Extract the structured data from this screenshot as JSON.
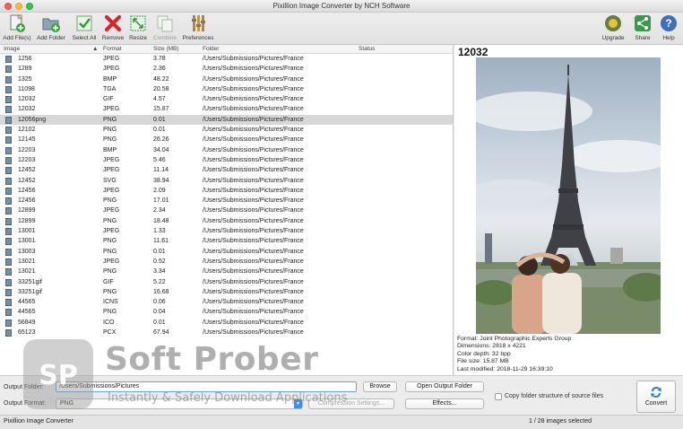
{
  "window": {
    "title": "Pixillion Image Converter by NCH Software"
  },
  "toolbar": {
    "buttons": [
      {
        "label": "Add File(s)",
        "icon": "add-file-icon",
        "enabled": true
      },
      {
        "label": "Add Folder",
        "icon": "add-folder-icon",
        "enabled": true
      },
      {
        "label": "Select All",
        "icon": "select-all-icon",
        "enabled": true
      },
      {
        "label": "Remove",
        "icon": "remove-icon",
        "enabled": true
      },
      {
        "label": "Resize",
        "icon": "resize-icon",
        "enabled": true
      },
      {
        "label": "Combine",
        "icon": "combine-icon",
        "enabled": false
      },
      {
        "label": "Preferences",
        "icon": "preferences-icon",
        "enabled": true
      }
    ],
    "right_buttons": [
      {
        "label": "Upgrade",
        "icon": "upgrade-icon"
      },
      {
        "label": "Share",
        "icon": "share-icon"
      },
      {
        "label": "Help",
        "icon": "help-icon"
      }
    ]
  },
  "file_list": {
    "columns": {
      "image": "Image",
      "format": "Format",
      "size": "Size (MB)",
      "folder": "Folder",
      "status": "Status"
    },
    "selected_index": 6,
    "rows": [
      {
        "image": "1256",
        "format": "JPEG",
        "size": "3.78",
        "folder": "/Users/Submissions/Pictures/France"
      },
      {
        "image": "1289",
        "format": "JPEG",
        "size": "2.36",
        "folder": "/Users/Submissions/Pictures/France"
      },
      {
        "image": "1325",
        "format": "BMP",
        "size": "48.22",
        "folder": "/Users/Submissions/Pictures/France"
      },
      {
        "image": "11098",
        "format": "TGA",
        "size": "20.58",
        "folder": "/Users/Submissions/Pictures/France"
      },
      {
        "image": "12032",
        "format": "GIF",
        "size": "4.57",
        "folder": "/Users/Submissions/Pictures/France"
      },
      {
        "image": "12032",
        "format": "JPEG",
        "size": "15.87",
        "folder": "/Users/Submissions/Pictures/France"
      },
      {
        "image": "12056png",
        "format": "PNG",
        "size": "0.01",
        "folder": "/Users/Submissions/Pictures/France"
      },
      {
        "image": "12102",
        "format": "PNG",
        "size": "0.01",
        "folder": "/Users/Submissions/Pictures/France"
      },
      {
        "image": "12145",
        "format": "PNG",
        "size": "26.26",
        "folder": "/Users/Submissions/Pictures/France"
      },
      {
        "image": "12203",
        "format": "BMP",
        "size": "34.04",
        "folder": "/Users/Submissions/Pictures/France"
      },
      {
        "image": "12203",
        "format": "JPEG",
        "size": "5.46",
        "folder": "/Users/Submissions/Pictures/France"
      },
      {
        "image": "12452",
        "format": "JPEG",
        "size": "11.14",
        "folder": "/Users/Submissions/Pictures/France"
      },
      {
        "image": "12452",
        "format": "SVG",
        "size": "38.94",
        "folder": "/Users/Submissions/Pictures/France"
      },
      {
        "image": "12456",
        "format": "JPEG",
        "size": "2.09",
        "folder": "/Users/Submissions/Pictures/France"
      },
      {
        "image": "12456",
        "format": "PNG",
        "size": "17.01",
        "folder": "/Users/Submissions/Pictures/France"
      },
      {
        "image": "12899",
        "format": "JPEG",
        "size": "2.34",
        "folder": "/Users/Submissions/Pictures/France"
      },
      {
        "image": "12899",
        "format": "PNG",
        "size": "18.48",
        "folder": "/Users/Submissions/Pictures/France"
      },
      {
        "image": "13001",
        "format": "JPEG",
        "size": "1.33",
        "folder": "/Users/Submissions/Pictures/France"
      },
      {
        "image": "13001",
        "format": "PNG",
        "size": "11.61",
        "folder": "/Users/Submissions/Pictures/France"
      },
      {
        "image": "13003",
        "format": "PNG",
        "size": "0.01",
        "folder": "/Users/Submissions/Pictures/France"
      },
      {
        "image": "13021",
        "format": "JPEG",
        "size": "0.52",
        "folder": "/Users/Submissions/Pictures/France"
      },
      {
        "image": "13021",
        "format": "PNG",
        "size": "3.34",
        "folder": "/Users/Submissions/Pictures/France"
      },
      {
        "image": "33251gif",
        "format": "GIF",
        "size": "5.22",
        "folder": "/Users/Submissions/Pictures/France"
      },
      {
        "image": "33251gif",
        "format": "PNG",
        "size": "16.68",
        "folder": "/Users/Submissions/Pictures/France"
      },
      {
        "image": "44565",
        "format": "ICNS",
        "size": "0.06",
        "folder": "/Users/Submissions/Pictures/France"
      },
      {
        "image": "44565",
        "format": "PNG",
        "size": "0.04",
        "folder": "/Users/Submissions/Pictures/France"
      },
      {
        "image": "56849",
        "format": "ICO",
        "size": "0.01",
        "folder": "/Users/Submissions/Pictures/France"
      },
      {
        "image": "65123",
        "format": "PCX",
        "size": "67.94",
        "folder": "/Users/Submissions/Pictures/France"
      }
    ]
  },
  "preview": {
    "title": "12032",
    "info": [
      "Format: Joint Photographic Experts Group",
      "Dimensions: 2818 x 4221",
      "Color depth: 32 bpp",
      "File size: 15.87 MB",
      "Last modified: 2018-11-29 16:39:10"
    ]
  },
  "output": {
    "folder_label": "Output Folder:",
    "folder_value": "/Users/Submissions/Pictures",
    "format_label": "Output Format:",
    "format_value": "PNG",
    "browse_label": "Browse",
    "open_folder_label": "Open Output Folder",
    "compression_label": "Compression Settings...",
    "effects_label": "Effects...",
    "copy_structure_label": "Copy folder structure of source files",
    "convert_label": "Convert"
  },
  "status": {
    "app_name": "Pixillion Image Converter",
    "selection": "1 / 28 images selected"
  },
  "watermark": {
    "logo_text": "SP",
    "title": "Soft Prober",
    "subtitle": "Instantly & Safely Download Applications"
  }
}
